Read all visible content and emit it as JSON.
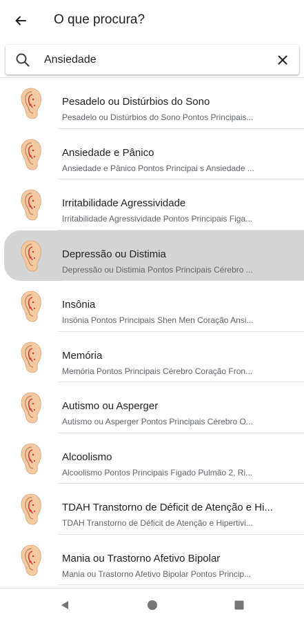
{
  "header": {
    "title": "O que procura?",
    "back_icon": "arrow-left-icon"
  },
  "search": {
    "value": "Ansiedade",
    "search_icon": "search-icon",
    "clear_icon": "close-icon"
  },
  "results": [
    {
      "title": "Pesadelo ou Distúrbios do Sono",
      "subtitle": "Pesadelo ou Distúrbios do Sono Pontos Principais...",
      "selected": false
    },
    {
      "title": "Ansiedade e Pânico",
      "subtitle": "Ansiedade e Pânico Pontos Principai s Ansiedade ...",
      "selected": false
    },
    {
      "title": "Irritabilidade Agressividade",
      "subtitle": "Irritabilidade Agressividade Pontos Principais Figa...",
      "selected": false
    },
    {
      "title": "Depressão ou Distimia",
      "subtitle": "Depressão ou Distimia Pontos Principais Cérebro ...",
      "selected": true
    },
    {
      "title": "Insônia",
      "subtitle": "Insônia Pontos Principais Shen Men Coração Ansi...",
      "selected": false
    },
    {
      "title": "Memória",
      "subtitle": "Memória Pontos Principais Cérebro Coração Fron...",
      "selected": false
    },
    {
      "title": "Autismo ou Asperger",
      "subtitle": "Autismo ou Asperger Pontos Principais Cérebro O...",
      "selected": false
    },
    {
      "title": "Alcoolismo",
      "subtitle": "Alcoolismo Pontos Principais Figado Pulmão 2, Ri...",
      "selected": false
    },
    {
      "title": "TDAH Transtorno de Déficit de Atenção e Hi...",
      "subtitle": "TDAH Transtorno de Déficit de Atenção e Hipertivi...",
      "selected": false
    },
    {
      "title": "Mania ou Trastorno Afetivo Bipolar",
      "subtitle": "Mania ou Trastorno Afetivo Bipolar Pontos Princip...",
      "selected": false
    }
  ],
  "navbar": {
    "back_icon": "triangle-back-icon",
    "home_icon": "circle-home-icon",
    "recents_icon": "square-recents-icon"
  },
  "colors": {
    "selected_row": "#d4d4d4",
    "ear_skin": "#f2c9a0",
    "ear_points": "#d83a2e"
  }
}
